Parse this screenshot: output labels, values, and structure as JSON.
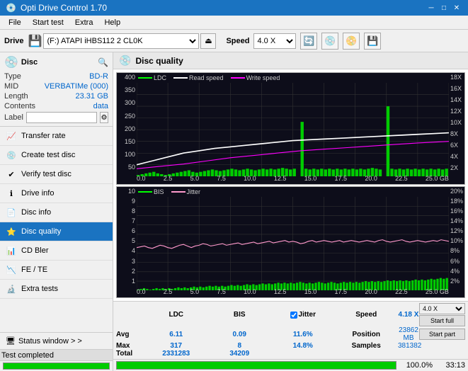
{
  "titlebar": {
    "title": "Opti Drive Control 1.70",
    "icon": "💿",
    "minimize": "─",
    "maximize": "□",
    "close": "✕"
  },
  "menubar": {
    "items": [
      "File",
      "Start test",
      "Extra",
      "Help"
    ]
  },
  "toolbar": {
    "drive_label": "Drive",
    "drive_value": "(F:) ATAPI iHBS112  2 CL0K",
    "speed_label": "Speed",
    "speed_value": "4.0 X"
  },
  "disc": {
    "title": "Disc",
    "type_label": "Type",
    "type_value": "BD-R",
    "mid_label": "MID",
    "mid_value": "VERBATIMe (000)",
    "length_label": "Length",
    "length_value": "23.31 GB",
    "contents_label": "Contents",
    "contents_value": "data",
    "label_label": "Label",
    "label_placeholder": ""
  },
  "nav": {
    "items": [
      {
        "id": "transfer-rate",
        "label": "Transfer rate",
        "icon": "📈"
      },
      {
        "id": "create-test-disc",
        "label": "Create test disc",
        "icon": "💿"
      },
      {
        "id": "verify-test-disc",
        "label": "Verify test disc",
        "icon": "✔"
      },
      {
        "id": "drive-info",
        "label": "Drive info",
        "icon": "ℹ"
      },
      {
        "id": "disc-info",
        "label": "Disc info",
        "icon": "📄"
      },
      {
        "id": "disc-quality",
        "label": "Disc quality",
        "icon": "⭐",
        "active": true
      },
      {
        "id": "cd-bler",
        "label": "CD Bler",
        "icon": "📊"
      },
      {
        "id": "fe-te",
        "label": "FE / TE",
        "icon": "📉"
      },
      {
        "id": "extra-tests",
        "label": "Extra tests",
        "icon": "🔬"
      }
    ],
    "status_window": "Status window > >"
  },
  "disc_quality": {
    "title": "Disc quality",
    "chart1": {
      "legend": [
        {
          "label": "LDC",
          "color": "#00ff00"
        },
        {
          "label": "Read speed",
          "color": "#ffffff"
        },
        {
          "label": "Write speed",
          "color": "#ff00ff"
        }
      ],
      "y_labels_left": [
        "400",
        "350",
        "300",
        "250",
        "200",
        "150",
        "100",
        "50",
        "0"
      ],
      "y_labels_right": [
        "18X",
        "16X",
        "14X",
        "12X",
        "10X",
        "8X",
        "6X",
        "4X",
        "2X"
      ],
      "x_labels": [
        "0.0",
        "2.5",
        "5.0",
        "7.5",
        "10.0",
        "12.5",
        "15.0",
        "17.5",
        "20.0",
        "22.5",
        "25.0 GB"
      ]
    },
    "chart2": {
      "legend": [
        {
          "label": "BIS",
          "color": "#00ff00"
        },
        {
          "label": "Jitter",
          "color": "#ff99cc"
        }
      ],
      "y_labels_left": [
        "10",
        "9",
        "8",
        "7",
        "6",
        "5",
        "4",
        "3",
        "2",
        "1"
      ],
      "y_labels_right": [
        "20%",
        "18%",
        "16%",
        "14%",
        "12%",
        "10%",
        "8%",
        "6%",
        "4%",
        "2%"
      ],
      "x_labels": [
        "0.0",
        "2.5",
        "5.0",
        "7.5",
        "10.0",
        "12.5",
        "15.0",
        "17.5",
        "20.0",
        "22.5",
        "25.0 GB"
      ]
    },
    "stats": {
      "col_headers": [
        "LDC",
        "BIS",
        "",
        "Jitter",
        "Speed"
      ],
      "avg_label": "Avg",
      "avg_ldc": "6.11",
      "avg_bis": "0.09",
      "avg_jitter": "11.6%",
      "avg_speed": "4.18 X",
      "max_label": "Max",
      "max_ldc": "317",
      "max_bis": "8",
      "max_jitter": "14.8%",
      "total_label": "Total",
      "total_ldc": "2331283",
      "total_bis": "34209",
      "position_label": "Position",
      "position_value": "23862 MB",
      "samples_label": "Samples",
      "samples_value": "381382",
      "speed_select": "4.0 X",
      "start_full_label": "Start full",
      "start_part_label": "Start part"
    },
    "progress": {
      "percent": 100.0,
      "percent_text": "100.0%",
      "time": "33:13"
    }
  },
  "status_bar": {
    "text": "Test completed"
  },
  "colors": {
    "active_nav": "#1a73c1",
    "blue_text": "#0066cc",
    "green": "#00cc00",
    "chart_bg": "#0a0a1a"
  }
}
